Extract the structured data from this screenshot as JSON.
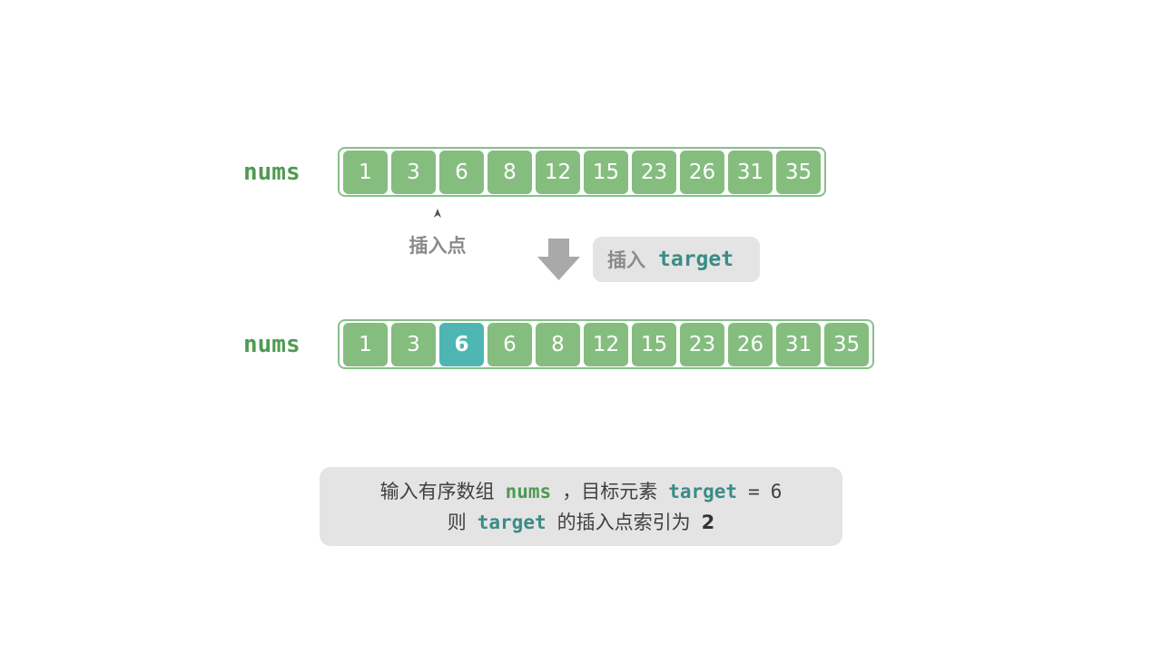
{
  "top_array": {
    "label": "nums",
    "values": [
      "1",
      "3",
      "6",
      "8",
      "12",
      "15",
      "23",
      "26",
      "31",
      "35"
    ]
  },
  "insert_point_label": "插入点",
  "insert_action": {
    "word": "插入",
    "code": "target"
  },
  "bottom_array": {
    "label": "nums",
    "values": [
      "1",
      "3",
      "6",
      "6",
      "8",
      "12",
      "15",
      "23",
      "26",
      "31",
      "35"
    ],
    "inserted_index": 2
  },
  "description": {
    "line1_prefix": "输入有序数组",
    "line1_var": "nums",
    "line1_middle": "，目标元素",
    "line1_target": "target",
    "line1_eq": "=",
    "line1_value": "6",
    "line2_prefix": "则",
    "line2_target": "target",
    "line2_middle": "的插入点索引为",
    "line2_result": "2"
  },
  "colors": {
    "cell": "#85bd7f",
    "inserted_cell": "#4eb6b2",
    "frame": "#86c08a",
    "label_green": "#4f9a52",
    "code_teal": "#3a8c88",
    "arrow_gray": "#a9a9a9",
    "pill_bg": "#e4e4e4"
  },
  "icons": {
    "pointer": "up-arrowhead-icon",
    "transition": "down-arrow-icon"
  }
}
